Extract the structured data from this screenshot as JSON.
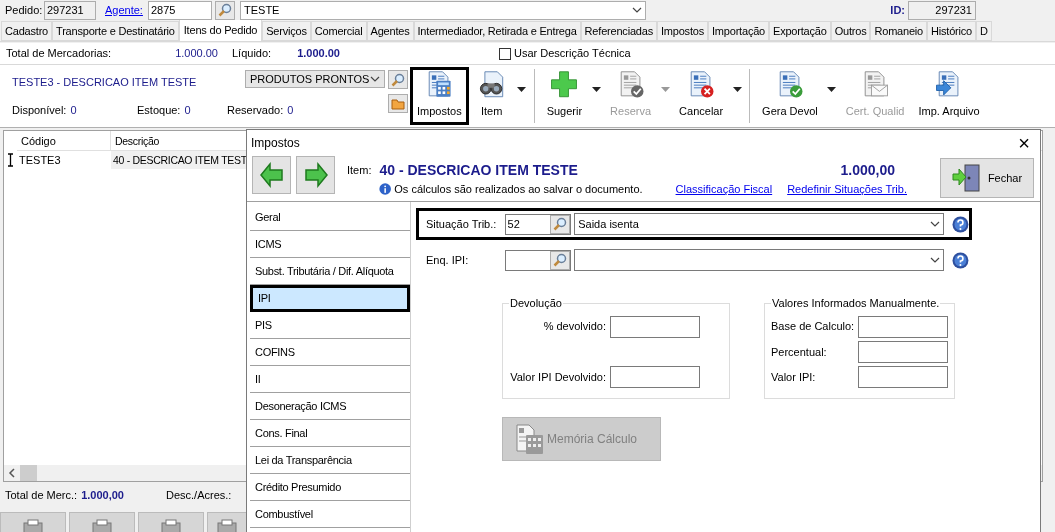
{
  "header": {
    "pedido_label": "Pedido:",
    "pedido": "297231",
    "agente_label": "Agente:",
    "agente": "2875",
    "cliente": "TESTE",
    "id_label": "ID:",
    "id": "297231"
  },
  "tabs": [
    {
      "label": "Cadastro",
      "selected": false
    },
    {
      "label": "Transporte e Destinatário",
      "selected": false
    },
    {
      "label": "Itens do Pedido",
      "selected": true
    },
    {
      "label": "Serviços",
      "selected": false
    },
    {
      "label": "Comercial",
      "selected": false
    },
    {
      "label": "Agentes",
      "selected": false
    },
    {
      "label": "Intermediador, Retirada e Entrega",
      "selected": false
    },
    {
      "label": "Referenciadas",
      "selected": false
    },
    {
      "label": "Impostos",
      "selected": false
    },
    {
      "label": "Importação",
      "selected": false
    },
    {
      "label": "Exportação",
      "selected": false
    },
    {
      "label": "Outros",
      "selected": false
    },
    {
      "label": "Romaneio",
      "selected": false
    },
    {
      "label": "Histórico",
      "selected": false
    },
    {
      "label": "D",
      "selected": false
    }
  ],
  "totals": {
    "mercadorias_label": "Total de Mercadorias:",
    "mercadorias": "1.000.00",
    "liquido_label": "Líquido:",
    "liquido": "1.000.00",
    "tech_desc": {
      "label": "Usar Descrição Técnica",
      "checked": false
    }
  },
  "item_panel": {
    "title": "TESTE3 - DESCRICAO ITEM TESTE",
    "category": "PRODUTOS PRONTOS",
    "stock": [
      {
        "label": "Disponível:",
        "value": "0"
      },
      {
        "label": "Estoque:",
        "value": "0"
      },
      {
        "label": "Reservado:",
        "value": "0"
      }
    ]
  },
  "toolbar": [
    {
      "label": "Impostos",
      "kind": "calculator",
      "disabled": false,
      "dropdown": false,
      "highlighted": true,
      "separator_before": false
    },
    {
      "label": "Item",
      "kind": "binoculars",
      "disabled": false,
      "dropdown": true,
      "highlighted": false,
      "separator_before": false
    },
    {
      "label": "Sugerir",
      "kind": "plus",
      "disabled": false,
      "dropdown": true,
      "highlighted": false,
      "separator_before": true
    },
    {
      "label": "Reserva",
      "kind": "approve",
      "disabled": true,
      "dropdown": true,
      "highlighted": false,
      "separator_before": false
    },
    {
      "label": "Cancelar",
      "kind": "cancel",
      "disabled": false,
      "dropdown": true,
      "highlighted": false,
      "separator_before": false
    },
    {
      "label": "Gera Devol",
      "kind": "approve",
      "disabled": false,
      "dropdown": true,
      "highlighted": false,
      "separator_before": true
    },
    {
      "label": "Cert. Qualid",
      "kind": "mail",
      "disabled": true,
      "dropdown": false,
      "highlighted": false,
      "separator_before": false
    },
    {
      "label": "Imp. Arquivo",
      "kind": "import",
      "disabled": false,
      "dropdown": false,
      "highlighted": false,
      "separator_before": false
    }
  ],
  "grid": {
    "columns": [
      "Código",
      "Descrição"
    ],
    "rows": [
      [
        "TESTE3",
        "40 - DESCRICAO ITEM TEST"
      ]
    ]
  },
  "footer": {
    "total_label": "Total de Merc.:",
    "total": "1.000,00",
    "desc_label": "Desc./Acres.:"
  },
  "dialog": {
    "title": "Impostos",
    "close": "×",
    "item_label": "Item:",
    "item": "40 - DESCRICAO ITEM TESTE",
    "amount": "1.000,00",
    "info": "Os cálculos são realizados ao salvar o documento.",
    "links": [
      "Classificação Fiscal",
      "Redefinir Situações Trib."
    ],
    "close_button": "Fechar",
    "nav": [
      {
        "label": "Geral",
        "selected": false,
        "highlighted": false
      },
      {
        "label": "ICMS",
        "selected": false,
        "highlighted": false
      },
      {
        "label": "Subst. Tributária / Dif. Alíquota",
        "selected": false,
        "highlighted": false
      },
      {
        "label": "IPI",
        "selected": true,
        "highlighted": true
      },
      {
        "label": "PIS",
        "selected": false,
        "highlighted": false
      },
      {
        "label": "COFINS",
        "selected": false,
        "highlighted": false
      },
      {
        "label": "II",
        "selected": false,
        "highlighted": false
      },
      {
        "label": "Desoneração ICMS",
        "selected": false,
        "highlighted": false
      },
      {
        "label": "Cons. Final",
        "selected": false,
        "highlighted": false
      },
      {
        "label": "Lei da Transparência",
        "selected": false,
        "highlighted": false
      },
      {
        "label": "Crédito Presumido",
        "selected": false,
        "highlighted": false
      },
      {
        "label": "Combustível",
        "selected": false,
        "highlighted": false
      }
    ],
    "fields": [
      {
        "label": "Situação Trib.:",
        "code": "52",
        "value": "Saida isenta",
        "highlighted": true
      },
      {
        "label": "Enq. IPI:",
        "highlighted": false
      }
    ],
    "groups": [
      {
        "title": "Devolução",
        "fields": [
          "% devolvido:",
          "Valor IPI Devolvido:"
        ]
      },
      {
        "title": "Valores Informados Manualmente.",
        "fields": [
          "Base de Calculo:",
          "Percentual:",
          "Valor IPI:"
        ]
      }
    ],
    "memoria_button": {
      "label": "Memória Cálculo",
      "disabled": true
    }
  }
}
